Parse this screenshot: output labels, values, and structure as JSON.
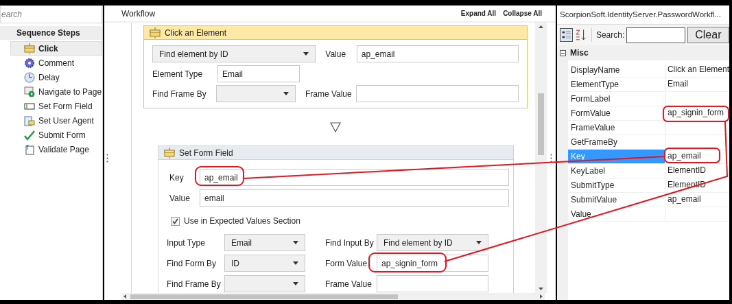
{
  "sidebar": {
    "search": {
      "placeholder": "earch"
    },
    "header": "Sequence Steps",
    "items": [
      {
        "label": "Click",
        "kind": "click",
        "selected": true
      },
      {
        "label": "Comment",
        "kind": "comment",
        "selected": false
      },
      {
        "label": "Delay",
        "kind": "delay",
        "selected": false
      },
      {
        "label": "Navigate to Page",
        "kind": "navigate",
        "selected": false
      },
      {
        "label": "Set Form Field",
        "kind": "formfield",
        "selected": false
      },
      {
        "label": "Set User Agent",
        "kind": "useragent",
        "selected": false
      },
      {
        "label": "Submit Form",
        "kind": "submit",
        "selected": false
      },
      {
        "label": "Validate Page",
        "kind": "validate",
        "selected": false
      }
    ]
  },
  "workflow": {
    "title": "Workflow",
    "actions": [
      "Expand All",
      "Collapse All"
    ],
    "click_card": {
      "title": "Click an Element",
      "selected": true,
      "find_by": "Find element by ID",
      "value_label": "Value",
      "value": "ap_email",
      "element_type_label": "Element Type",
      "element_type": "Email",
      "find_frame_label": "Find Frame By",
      "frame_value_label": "Frame Value"
    },
    "form_card": {
      "title": "Set Form Field",
      "selected": false,
      "key_label": "Key",
      "key": "ap_email",
      "value_label": "Value",
      "value": "email",
      "checkbox": {
        "label": "Use in Expected Values Section",
        "checked": true
      },
      "input_type_label": "Input Type",
      "input_type": "Email",
      "find_input_label": "Find Input By",
      "find_input": "Find element by ID",
      "find_form_label": "Find Form By",
      "find_form": "ID",
      "form_value_label": "Form Value",
      "form_value": "ap_signin_form",
      "find_frame_label": "Find Frame By",
      "frame_value_label": "Frame Value"
    }
  },
  "properties": {
    "title": "ScorpionSoft.IdentityServer.PasswordWorkfl...",
    "search_label": "Search:",
    "clear_button": "Clear",
    "category": {
      "label": "Misc",
      "expanded": true
    },
    "rows": [
      {
        "name": "DisplayName",
        "value": "Click an Element",
        "selected": false
      },
      {
        "name": "ElementType",
        "value": "Email",
        "selected": false
      },
      {
        "name": "FormLabel",
        "selected": false
      },
      {
        "name": "FormValue",
        "value": "ap_signin_form",
        "selected": false
      },
      {
        "name": "FrameValue",
        "selected": false
      },
      {
        "name": "GetFrameBy",
        "selected": false
      },
      {
        "name": "Key",
        "value": "ap_email",
        "selected": true
      },
      {
        "name": "KeyLabel",
        "value": "ElementID",
        "selected": false
      },
      {
        "name": "SubmitType",
        "value": "ElementID",
        "selected": false
      },
      {
        "name": "SubmitValue",
        "value": "ap_email",
        "selected": false
      },
      {
        "name": "Value",
        "selected": false
      }
    ]
  }
}
